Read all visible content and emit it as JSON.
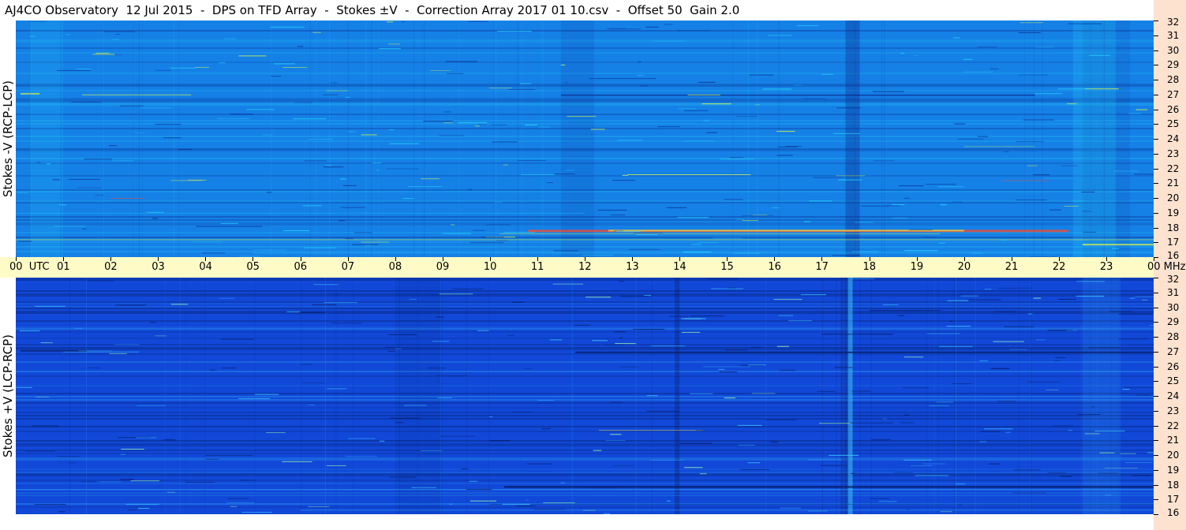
{
  "title": "AJ4CO Observatory  12 Jul 2015  -  DPS on TFD Array  -  Stokes ±V  -  Correction Array 2017 01 10.csv  -  Offset 50  Gain 2.0",
  "chart_data": [
    {
      "type": "heatmap",
      "panel": "top",
      "ylabel": "Stokes -V (RCP-LCP)",
      "xlabel": "UTC",
      "xlim": [
        0,
        24
      ],
      "ylim": [
        16,
        32
      ],
      "y_unit": "MHz",
      "x_ticks": [
        "00",
        "01",
        "02",
        "03",
        "04",
        "05",
        "06",
        "07",
        "08",
        "09",
        "10",
        "11",
        "12",
        "13",
        "14",
        "15",
        "16",
        "17",
        "18",
        "19",
        "20",
        "21",
        "22",
        "23",
        "00"
      ],
      "y_ticks": [
        16,
        17,
        18,
        19,
        20,
        21,
        22,
        23,
        24,
        25,
        26,
        27,
        28,
        29,
        30,
        31,
        32
      ],
      "colors": {
        "base": "#1581e6",
        "low": "#0a2a8c",
        "high": "#29e0ff",
        "hot": "#ff4a2a",
        "warm": "#e8ff40"
      }
    },
    {
      "type": "heatmap",
      "panel": "bottom",
      "ylabel": "Stokes +V (LCP-RCP)",
      "xlabel": "UTC",
      "xlim": [
        0,
        24
      ],
      "ylim": [
        16,
        32
      ],
      "y_unit": "MHz",
      "x_ticks": [
        "00",
        "01",
        "02",
        "03",
        "04",
        "05",
        "06",
        "07",
        "08",
        "09",
        "10",
        "11",
        "12",
        "13",
        "14",
        "15",
        "16",
        "17",
        "18",
        "19",
        "20",
        "21",
        "22",
        "23",
        "00"
      ],
      "y_ticks": [
        16,
        17,
        18,
        19,
        20,
        21,
        22,
        23,
        24,
        25,
        26,
        27,
        28,
        29,
        30,
        31,
        32
      ],
      "colors": {
        "base": "#1148d8",
        "low": "#061a5e",
        "high": "#3fd0ff",
        "hot": "#ffef40",
        "warm": "#a0ffb0"
      }
    }
  ],
  "axis": {
    "time_first_label": "00  UTC",
    "time_last_label": "00",
    "freq_unit": "MHz"
  }
}
